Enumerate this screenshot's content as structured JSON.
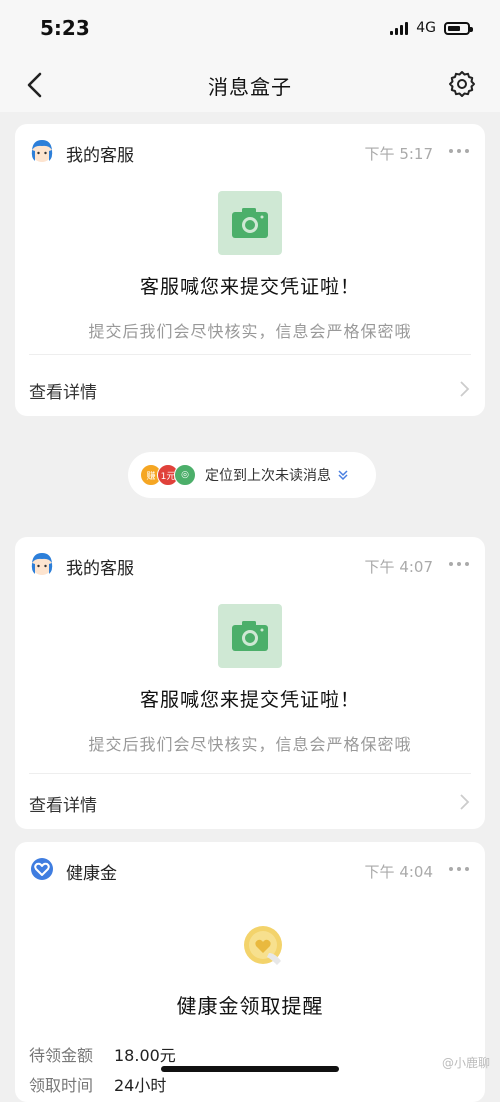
{
  "status": {
    "time": "5:23",
    "network": "4G"
  },
  "nav": {
    "title": "消息盒子",
    "back_icon": "chevron-left-icon",
    "settings_icon": "gear-icon"
  },
  "messages": [
    {
      "sender": "我的客服",
      "time": "下午 5:17",
      "title": "客服喊您来提交凭证啦！",
      "subtitle": "提交后我们会尽快核实，信息会严格保密哦",
      "detail": "查看详情"
    },
    {
      "sender": "我的客服",
      "time": "下午 4:07",
      "title": "客服喊您来提交凭证啦！",
      "subtitle": "提交后我们会尽快核实，信息会严格保密哦",
      "detail": "查看详情"
    },
    {
      "sender": "健康金",
      "time": "下午 4:04",
      "title": "健康金领取提醒",
      "fields": [
        {
          "label": "待领金额",
          "value": "18.00元"
        },
        {
          "label": "领取时间",
          "value": "24小时"
        }
      ]
    }
  ],
  "locate": {
    "text": "定位到上次未读消息",
    "badges": [
      "赚",
      "1元",
      "◎"
    ]
  },
  "watermark": "@小鹿聊",
  "colors": {
    "brand_green": "#4caf6a",
    "camera_bg": "#cfe8d4",
    "health_blue": "#3f7de0"
  }
}
